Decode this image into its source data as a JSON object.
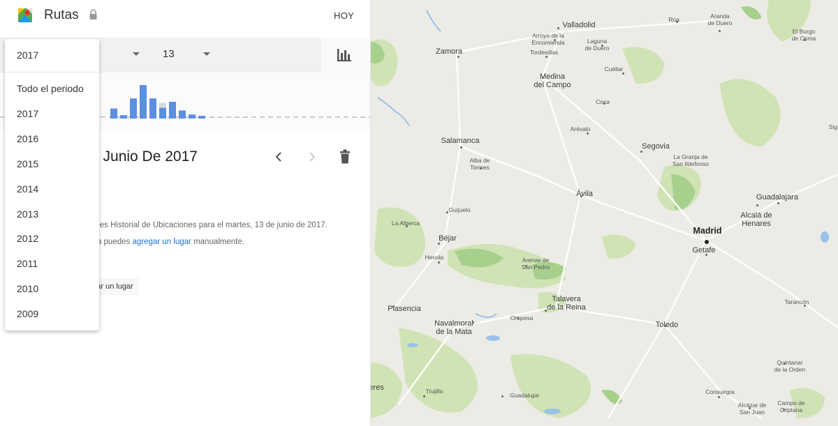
{
  "header": {
    "title": "Rutas",
    "today_label": "HOY",
    "logo_icon": "google-maps-icon",
    "lock_icon": "lock-icon"
  },
  "filters": {
    "year_selected": "2017",
    "day_value": "13",
    "year_options": [
      "Todo el periodo",
      "2017",
      "2016",
      "2015",
      "2014",
      "2013",
      "2012",
      "2011",
      "2010",
      "2009"
    ]
  },
  "histogram": {
    "color": "#5b8fe0",
    "values": [
      0.3,
      0.1,
      0.6,
      1.0,
      0.6,
      0.32,
      0.5,
      0.24,
      0.12,
      0.08
    ],
    "ghost_values": [
      0,
      0,
      0,
      0,
      0.55,
      0.47,
      0,
      0,
      0,
      0
    ]
  },
  "day_view": {
    "title": "e Junio De 2017",
    "no_history_text": "enes Historial de Ubicaciones para el martes, 13 de junio de 2017.",
    "manual_prefix": "vía puedes ",
    "manual_link": "agregar un lugar",
    "manual_suffix": " manualmente.",
    "add_place_button": "egar un lugar"
  },
  "map": {
    "cities": [
      {
        "name": "Valladolid",
        "cls": ""
      },
      {
        "name": "Aranda\nde Duero",
        "cls": "small"
      },
      {
        "name": "Roa",
        "cls": "small"
      },
      {
        "name": "El Burgo\nde Osma",
        "cls": "small"
      },
      {
        "name": "Arroyo de la\nEncomienda",
        "cls": "small"
      },
      {
        "name": "Laguna\nde Duero",
        "cls": "small"
      },
      {
        "name": "Tordesillas",
        "cls": "small"
      },
      {
        "name": "Zamora",
        "cls": ""
      },
      {
        "name": "Medina\ndel Campo",
        "cls": ""
      },
      {
        "name": "Cuéllar",
        "cls": "small"
      },
      {
        "name": "Coca",
        "cls": "small"
      },
      {
        "name": "Arévalo",
        "cls": "small"
      },
      {
        "name": "Salamanca",
        "cls": ""
      },
      {
        "name": "Alba de\nTormes",
        "cls": "small"
      },
      {
        "name": "Segovia",
        "cls": ""
      },
      {
        "name": "La Granja de\nSan Ildefonso",
        "cls": "small"
      },
      {
        "name": "Ávila",
        "cls": ""
      },
      {
        "name": "Guadalajara",
        "cls": ""
      },
      {
        "name": "Guijuelo",
        "cls": "small"
      },
      {
        "name": "La Alberca",
        "cls": "small"
      },
      {
        "name": "Alcalá de\nHenares",
        "cls": ""
      },
      {
        "name": "Madrid",
        "cls": "big"
      },
      {
        "name": "Béjar",
        "cls": ""
      },
      {
        "name": "Getafe",
        "cls": ""
      },
      {
        "name": "Hervás",
        "cls": "small"
      },
      {
        "name": "Arenas de\nSan Pedro",
        "cls": "small"
      },
      {
        "name": "Talavera\nde la Reina",
        "cls": ""
      },
      {
        "name": "Plasencia",
        "cls": ""
      },
      {
        "name": "Oropesa",
        "cls": "small"
      },
      {
        "name": "Navalmoral\nde la Mata",
        "cls": ""
      },
      {
        "name": "Toledo",
        "cls": ""
      },
      {
        "name": "Tarancón",
        "cls": "small"
      },
      {
        "name": "Quintanar\nde la Orden",
        "cls": "small"
      },
      {
        "name": "Trujillo",
        "cls": "small"
      },
      {
        "name": "Guadalupe",
        "cls": "small"
      },
      {
        "name": "Consuegra",
        "cls": "small"
      },
      {
        "name": "Alcázar de\nSan Juan",
        "cls": "small"
      },
      {
        "name": "Campo de\nCriptana",
        "cls": "small"
      },
      {
        "name": "eres",
        "cls": ""
      },
      {
        "name": "Sig",
        "cls": "small"
      }
    ]
  }
}
